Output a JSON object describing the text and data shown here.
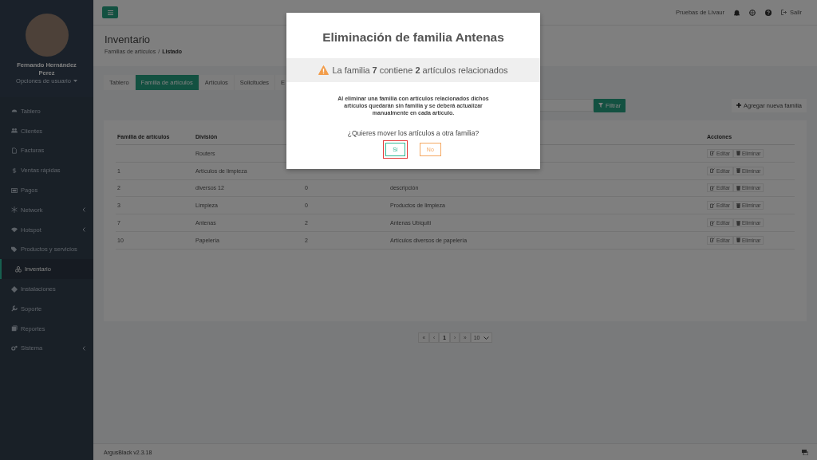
{
  "sidebar": {
    "user": {
      "name": "Fernando Hernández Perez",
      "options": "Opciones de usuario"
    },
    "items": [
      {
        "label": "Tablero",
        "selected": false,
        "submenu": false
      },
      {
        "label": "Clientes",
        "selected": false,
        "submenu": false
      },
      {
        "label": "Facturas",
        "selected": false,
        "submenu": false
      },
      {
        "label": "Ventas rápidas",
        "selected": false,
        "submenu": false
      },
      {
        "label": "Pagos",
        "selected": false,
        "submenu": false
      },
      {
        "label": "Network",
        "selected": false,
        "submenu": true
      },
      {
        "label": "Hotspot",
        "selected": false,
        "submenu": true
      },
      {
        "label": "Productos y servicios",
        "selected": false,
        "submenu": false
      },
      {
        "label": "Inventario",
        "selected": true,
        "submenu": false
      },
      {
        "label": "Instalaciones",
        "selected": false,
        "submenu": false
      },
      {
        "label": "Soporte",
        "selected": false,
        "submenu": false
      },
      {
        "label": "Reportes",
        "selected": false,
        "submenu": false
      },
      {
        "label": "Sistema",
        "selected": false,
        "submenu": true
      }
    ]
  },
  "topbar": {
    "account": "Pruebas de Livaur",
    "logout": "Salir"
  },
  "page": {
    "title": "Inventario",
    "breadcrumb": [
      "Familias de artículos",
      "Listado"
    ],
    "breadcrumb_separator": "/"
  },
  "tabs": [
    {
      "label": "Tablero",
      "selected": false
    },
    {
      "label": "Familia de artículos",
      "selected": true
    },
    {
      "label": "Artículos",
      "selected": false
    },
    {
      "label": "Solicitudes",
      "selected": false
    },
    {
      "label": "E",
      "selected": false
    }
  ],
  "filter_button": "Filtrar",
  "add_button": "Agregar nueva familia",
  "table": {
    "columns": [
      "Familia de artículos",
      "División",
      "Acciones"
    ],
    "rows": [
      {
        "division": "Routers",
        "actions": [
          "Editar",
          "Eliminar"
        ]
      },
      {
        "familia": "1",
        "division": "Artículos de limpieza",
        "actions": [
          "Editar",
          "Eliminar"
        ]
      },
      {
        "familia": "2",
        "division": "diversos 12",
        "column_3": "0",
        "column_4": "descripción",
        "actions": [
          "Editar",
          "Eliminar"
        ]
      },
      {
        "familia": "3",
        "division": "Limpieza",
        "column_3": "0",
        "column_4": "Productos de limpieza",
        "actions": [
          "Editar",
          "Eliminar"
        ]
      },
      {
        "familia": "7",
        "division": "Antenas",
        "column_3": "2",
        "column_4": "Antenas Ubiquiti",
        "actions": [
          "Editar",
          "Eliminar"
        ]
      },
      {
        "familia": "10",
        "division": "Papelería",
        "column_3": "2",
        "column_4": "Artículos diversos de papelería",
        "actions": [
          "Editar",
          "Eliminar"
        ]
      }
    ]
  },
  "pagination": {
    "first": "«",
    "prev": "‹",
    "pages": [
      {
        "label": "1",
        "selected": true
      }
    ],
    "next": "›",
    "last": "»",
    "page_size": "10"
  },
  "footer": {
    "version": "ArgusBlack v2.3.18"
  },
  "modal": {
    "title": "Eliminación de familia Antenas",
    "alert": "La familia **7** contiene **2** artículos relacionados",
    "message": "Al eliminar una familia con artículos relacionados dichos artículos quedarán sin familia y se deberá actualizar manualmente en cada artículo.",
    "question": "¿Quieres mover los artículos a otra familia?",
    "buttons": [
      {
        "label": "Sí",
        "kind": "confirm",
        "focused": true
      },
      {
        "label": "No",
        "kind": "cancel",
        "focused": false
      }
    ]
  }
}
